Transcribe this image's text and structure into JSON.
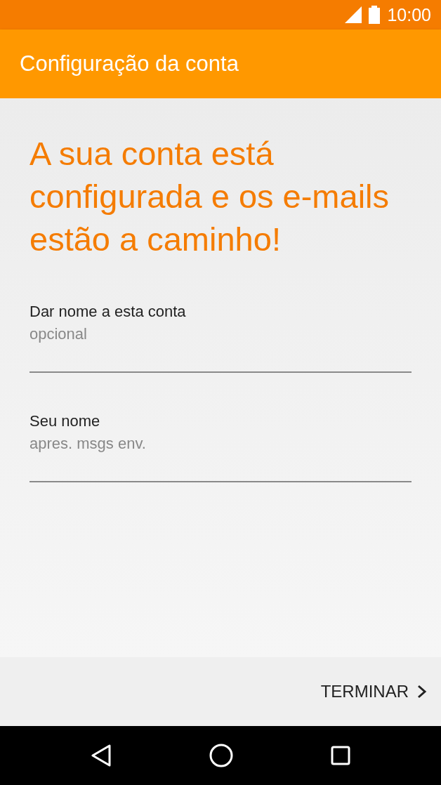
{
  "status_bar": {
    "time": "10:00"
  },
  "app_bar": {
    "title": "Configuração da conta"
  },
  "heading": "A sua conta está configurada e os e-mails estão a caminho!",
  "fields": [
    {
      "label": "Dar nome a esta conta",
      "placeholder": "opcional"
    },
    {
      "label": "Seu nome",
      "placeholder": "apres. msgs env."
    }
  ],
  "footer": {
    "button": "TERMINAR"
  }
}
